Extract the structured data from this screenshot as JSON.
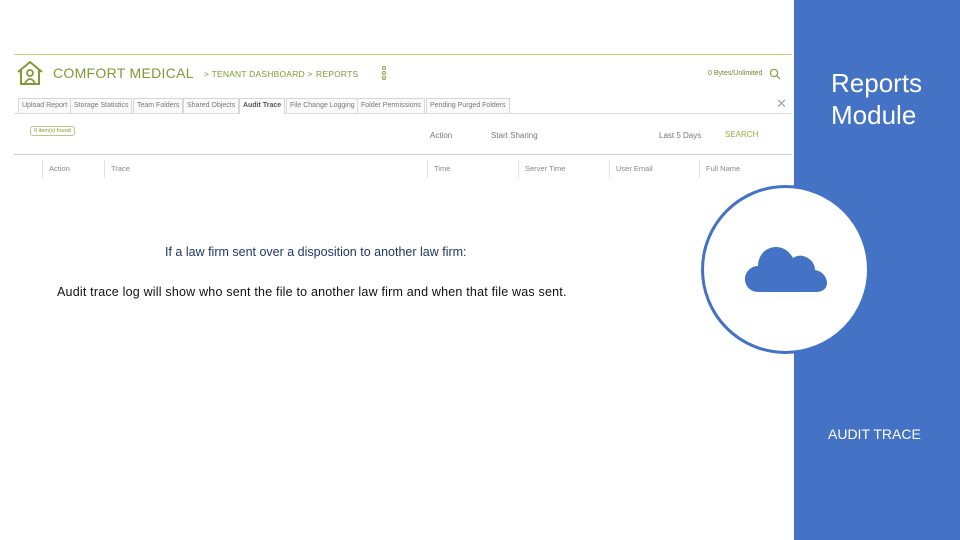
{
  "app": {
    "brand": "COMFORT MEDICAL",
    "breadcrumb": [
      "> TENANT DASHBOARD >",
      "REPORTS"
    ],
    "usage": "0 Bytes/Unlimited",
    "icons": {
      "logo": "home-user-logo-icon",
      "more": "more-vertical-icon",
      "search": "search-icon",
      "close": "close-icon"
    },
    "tabs": [
      {
        "label": "Upload Report",
        "active": false
      },
      {
        "label": "Storage Statistics",
        "active": false
      },
      {
        "label": "Team Folders",
        "active": false
      },
      {
        "label": "Shared Objects",
        "active": false
      },
      {
        "label": "Audit Trace",
        "active": true
      },
      {
        "label": "File Change Logging",
        "active": false
      },
      {
        "label": "Folder Permissions",
        "active": false
      },
      {
        "label": "Pending Purged Folders",
        "active": false
      }
    ],
    "close_label": "✕",
    "filters": {
      "badge": "0 item(s) found",
      "action": "Action",
      "start": "Start Sharing",
      "days": "Last 5 Days",
      "search": "SEARCH"
    },
    "columns": [
      "Action",
      "Trace",
      "Time",
      "Server Time",
      "User Email",
      "Full Name"
    ]
  },
  "slide": {
    "caption": "If a law firm sent over a disposition to another law firm:",
    "body": "Audit trace log will show who sent the file to another law firm and when that file was sent."
  },
  "side": {
    "title_line1": "Reports",
    "title_line2": "Module",
    "caption": "AUDIT TRACE",
    "icon": "cloud-icon"
  },
  "colors": {
    "panel_blue": "#4472c4",
    "brand_green": "#7d9a34",
    "caption_navy": "#1f3864"
  }
}
